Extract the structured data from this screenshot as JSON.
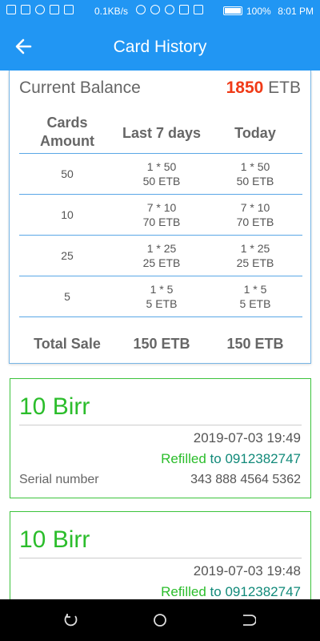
{
  "status_bar": {
    "speed": "0.1KB/s",
    "battery_percent": "100%",
    "time": "8:01 PM"
  },
  "header": {
    "title": "Card History"
  },
  "balance": {
    "label": "Current Balance",
    "amount": "1850",
    "currency": "ETB"
  },
  "table": {
    "headers": [
      "Cards\nAmount",
      "Last 7 days",
      "Today"
    ],
    "rows": [
      {
        "amount": "50",
        "last7_count": "1 * 50",
        "last7_total": "50 ETB",
        "today_count": "1 * 50",
        "today_total": "50 ETB"
      },
      {
        "amount": "10",
        "last7_count": "7 * 10",
        "last7_total": "70 ETB",
        "today_count": "7 * 10",
        "today_total": "70 ETB"
      },
      {
        "amount": "25",
        "last7_count": "1 * 25",
        "last7_total": "25 ETB",
        "today_count": "1 * 25",
        "today_total": "25 ETB"
      },
      {
        "amount": "5",
        "last7_count": "1 * 5",
        "last7_total": "5 ETB",
        "today_count": "1 * 5",
        "today_total": "5 ETB"
      }
    ],
    "total": {
      "label": "Total Sale",
      "last7": "150 ETB",
      "today": "150 ETB"
    }
  },
  "transactions": [
    {
      "amount": "10 Birr",
      "datetime": "2019-07-03 19:49",
      "refilled_label": "Refilled",
      "to_label": "to",
      "phone": "0912382747",
      "serial_label": "Serial number",
      "serial": "343 888 4564 5362"
    },
    {
      "amount": "10 Birr",
      "datetime": "2019-07-03 19:48",
      "refilled_label": "Refilled",
      "to_label": "to",
      "phone": "0912382747",
      "serial_label": "",
      "serial": ""
    }
  ],
  "colors": {
    "primary": "#2196f3",
    "balance_amount": "#f03a17",
    "success": "#2bbd2b",
    "phone": "#128a7a"
  },
  "icons": {
    "back": "arrow-left-icon",
    "nav_back": "back-nav-icon",
    "nav_home": "home-nav-icon",
    "nav_recent": "recents-nav-icon"
  }
}
